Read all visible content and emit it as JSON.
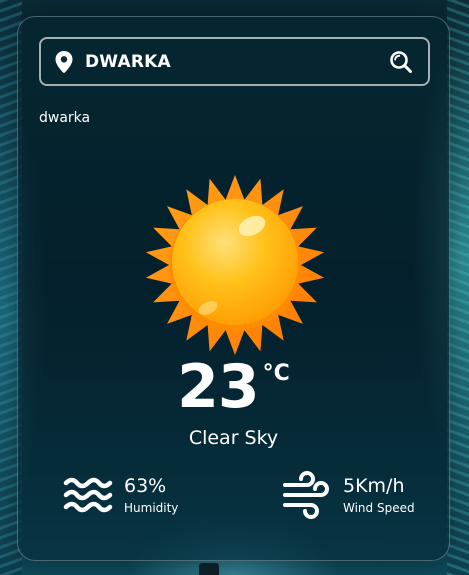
{
  "search": {
    "value": "DWARKA",
    "pin_icon": "location-pin-icon",
    "search_icon": "search-icon"
  },
  "location": {
    "name": "dwarka"
  },
  "weather": {
    "icon": "sun-icon",
    "temperature": "23",
    "unit": "°C",
    "condition": "Clear Sky"
  },
  "stats": {
    "humidity": {
      "icon": "humidity-waves-icon",
      "value": "63%",
      "label": "Humidity"
    },
    "wind": {
      "icon": "wind-icon",
      "value": "5Km/h",
      "label": "Wind Speed"
    }
  },
  "colors": {
    "sun_outer": "#FF8A00",
    "sun_inner": "#FFB300",
    "text": "#FFFFFF"
  }
}
